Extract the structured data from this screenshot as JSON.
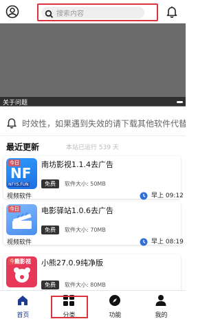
{
  "search": {
    "placeholder": "搜索内容"
  },
  "banner": {
    "caption": "关于问题"
  },
  "notice": {
    "text": "时效性，如果遇到失效的请下载其他软件代替"
  },
  "recent": {
    "title": "最近更新",
    "uptime": "本站已运行 539 天"
  },
  "apps": [
    {
      "title": "南坊影视1.1.4去广告",
      "badge": "免费",
      "size": "软件大小: 50MB",
      "category": "视频软件",
      "time": "早上 09:12",
      "thumb_tag": "今日",
      "thumb_text": "NF",
      "thumb_sub": "NFYS.FUN"
    },
    {
      "title": "电影驿站1.0.6去广告",
      "badge": "免费",
      "size": "软件大小: 70MB",
      "category": "视频软件",
      "time": "早上 08:19",
      "thumb_tag": "今日"
    },
    {
      "title": "小熊27.0.9纯净版",
      "badge": "免费",
      "size": "软件大小: 80MB",
      "category": "",
      "time": "",
      "thumb_tag": "今日",
      "thumb_text": "熊影视"
    }
  ],
  "nav": [
    {
      "label": "首页",
      "icon": "home-icon"
    },
    {
      "label": "分类",
      "icon": "grid-icon"
    },
    {
      "label": "功能",
      "icon": "compass-icon"
    },
    {
      "label": "我的",
      "icon": "person-icon"
    }
  ],
  "colors": {
    "accent": "#1f3a93",
    "highlight": "#d9343b",
    "clock": "#2f6fd6"
  }
}
